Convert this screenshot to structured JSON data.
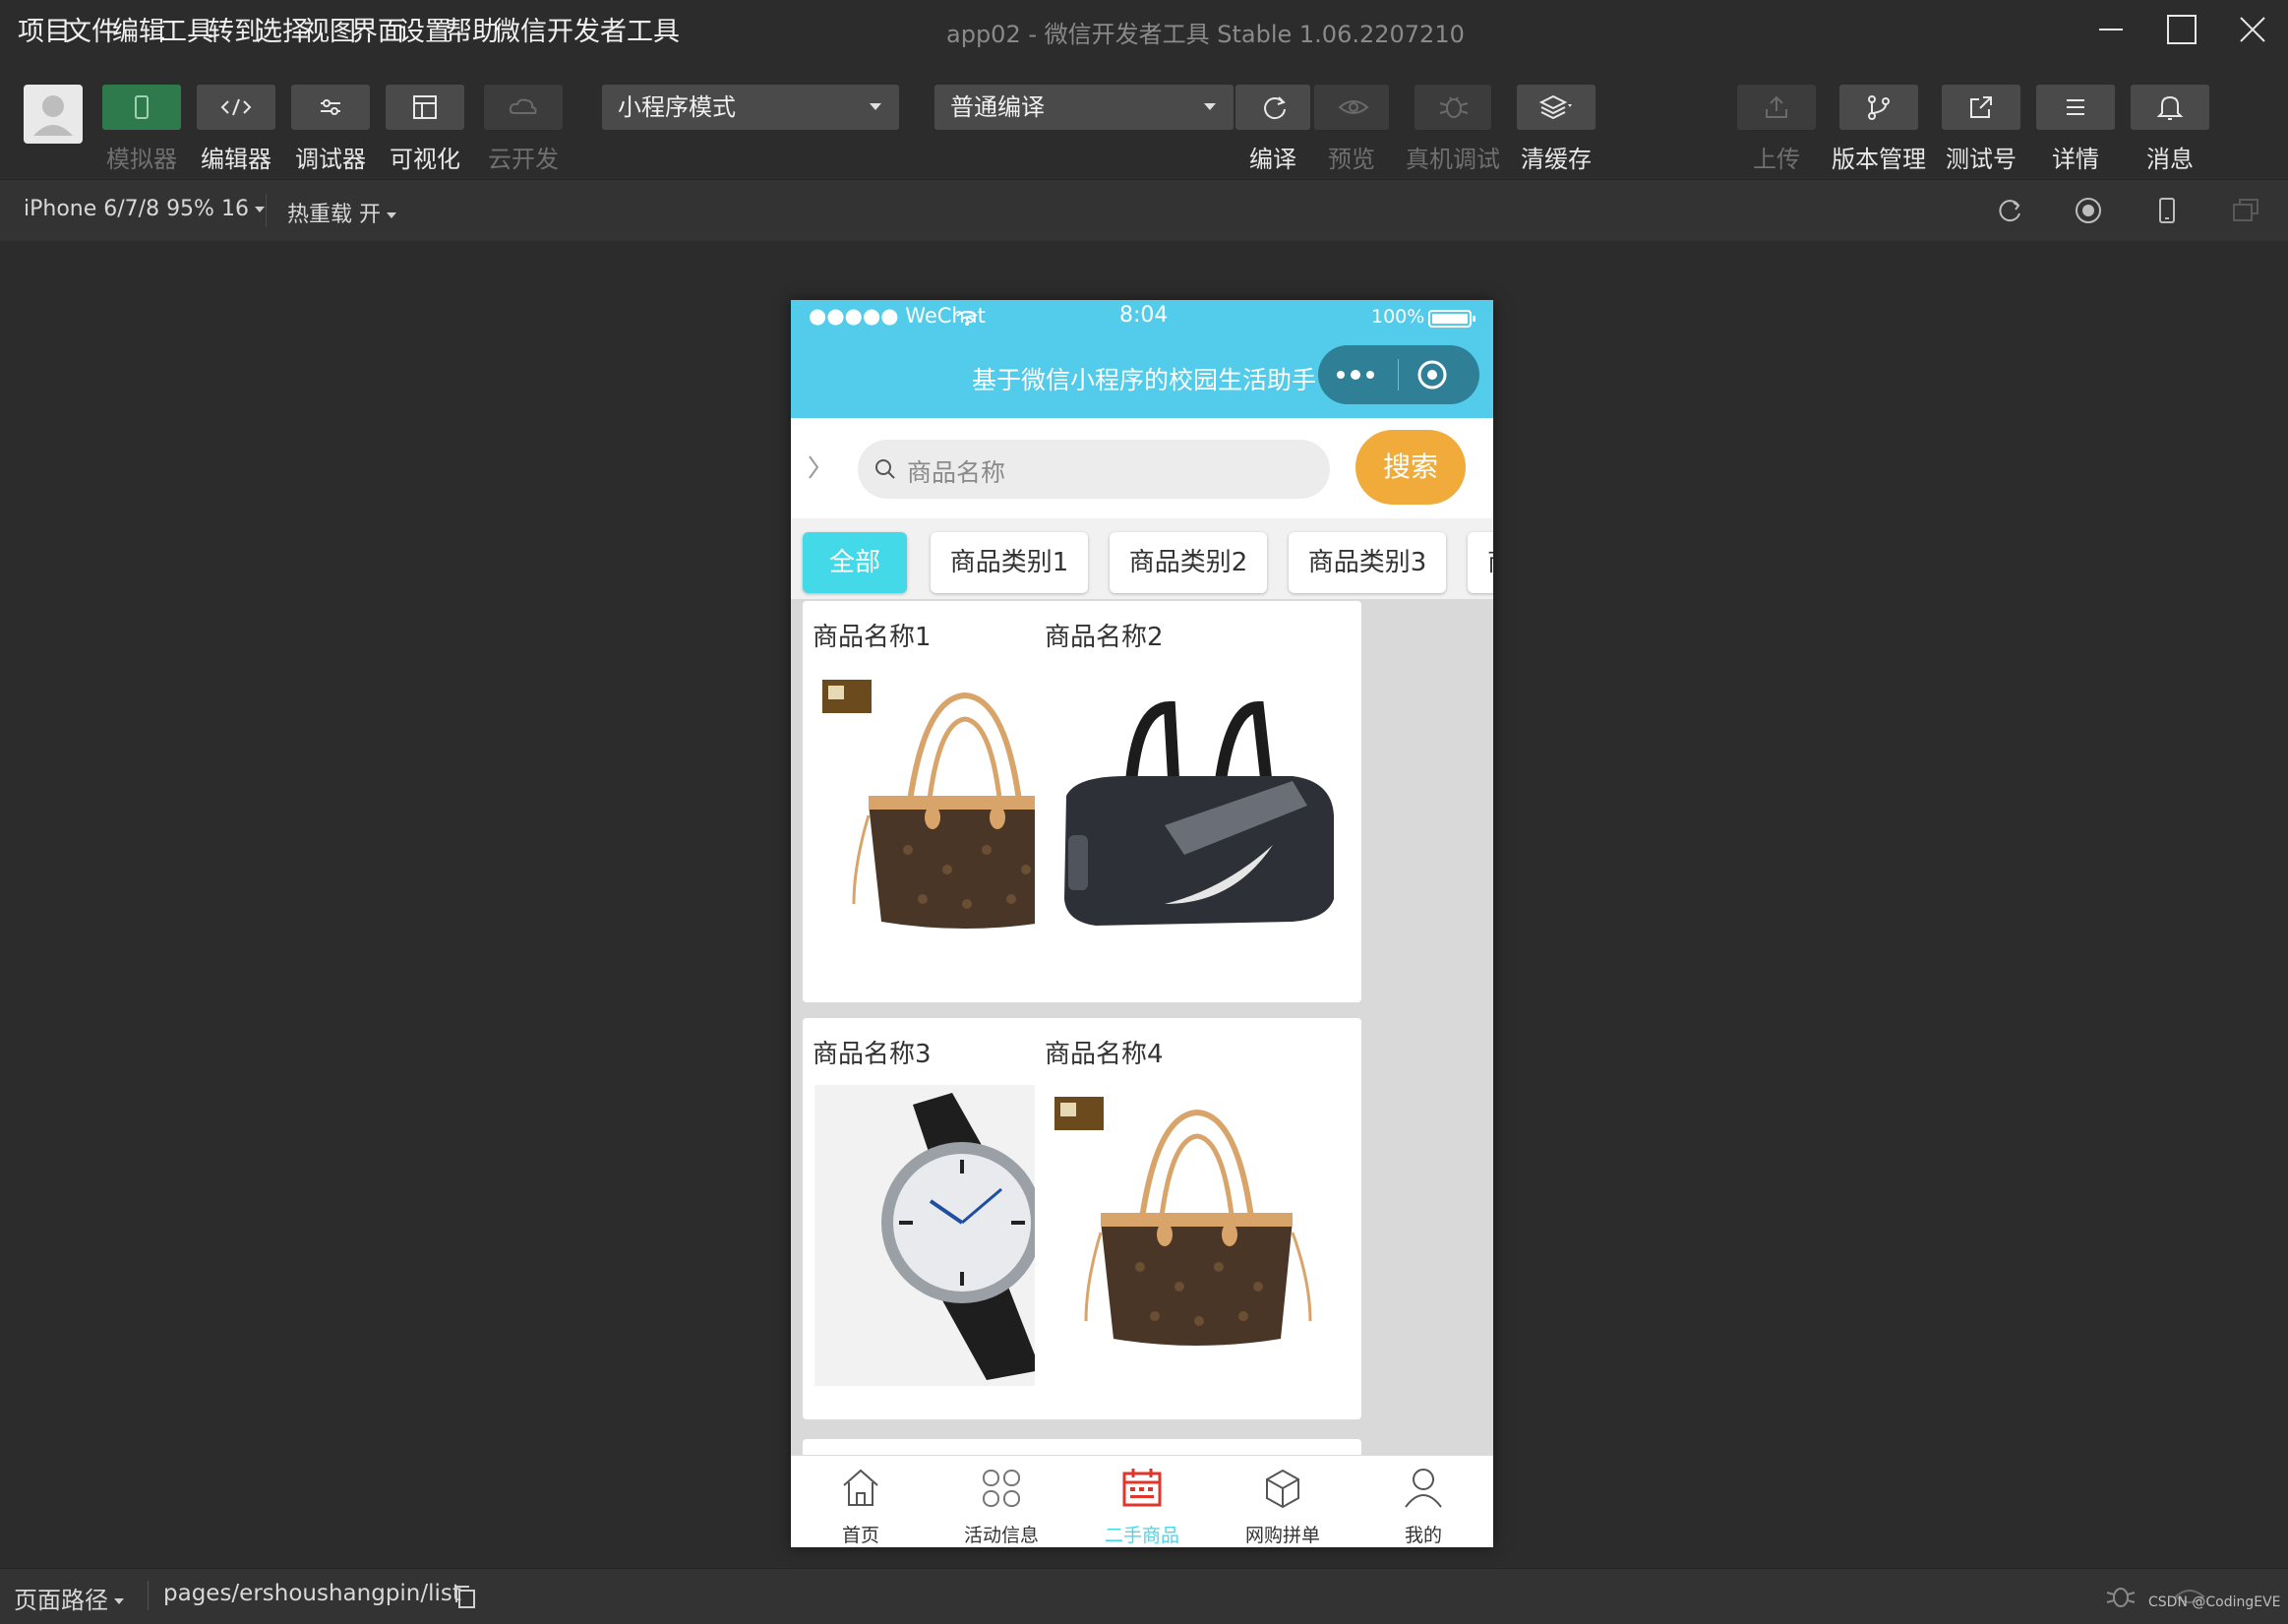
{
  "menu": [
    "项目",
    "文件",
    "编辑",
    "工具",
    "转到",
    "选择",
    "视图",
    "界面",
    "设置",
    "帮助",
    "微信开发者工具"
  ],
  "window_title": "app02 - 微信开发者工具 Stable 1.06.2207210",
  "toolbar": {
    "left_buttons": [
      {
        "label": "模拟器",
        "icon": "phone-icon",
        "state": "active"
      },
      {
        "label": "编辑器",
        "icon": "code-icon",
        "state": "normal"
      },
      {
        "label": "调试器",
        "icon": "sliders-icon",
        "state": "normal"
      },
      {
        "label": "可视化",
        "icon": "layout-icon",
        "state": "normal"
      },
      {
        "label": "云开发",
        "icon": "cloud-icon",
        "state": "disabled"
      }
    ],
    "mode_select": "小程序模式",
    "compile_select": "普通编译",
    "action_buttons": [
      {
        "label": "编译",
        "icon": "refresh-icon",
        "state": "normal"
      },
      {
        "label": "预览",
        "icon": "eye-icon",
        "state": "disabled"
      },
      {
        "label": "真机调试",
        "icon": "bug-icon",
        "state": "disabled"
      },
      {
        "label": "清缓存",
        "icon": "layers-icon",
        "state": "normal"
      }
    ],
    "right_buttons": [
      {
        "label": "上传",
        "icon": "upload-icon",
        "state": "disabled"
      },
      {
        "label": "版本管理",
        "icon": "branch-icon",
        "state": "normal"
      },
      {
        "label": "测试号",
        "icon": "external-link-icon",
        "state": "normal"
      },
      {
        "label": "详情",
        "icon": "menu-icon",
        "state": "normal"
      },
      {
        "label": "消息",
        "icon": "bell-icon",
        "state": "normal"
      }
    ]
  },
  "subbar": {
    "device": "iPhone 6/7/8 95% 16",
    "hot_reload": "热重载 开"
  },
  "phone": {
    "signal": "●●●●● WeChat",
    "time": "8:04",
    "battery": "100%",
    "nav_title": "基于微信小程序的校园生活助手",
    "search_placeholder": "商品名称",
    "search_button": "搜索",
    "tabs": [
      "全部",
      "商品类别1",
      "商品类别2",
      "商品类别3",
      "商"
    ],
    "products": [
      {
        "name": "商品名称1",
        "image": "handbag"
      },
      {
        "name": "商品名称2",
        "image": "duffel-bag"
      },
      {
        "name": "商品名称3",
        "image": "watch"
      },
      {
        "name": "商品名称4",
        "image": "handbag"
      }
    ],
    "tabbar": [
      {
        "label": "首页",
        "icon": "home-icon"
      },
      {
        "label": "活动信息",
        "icon": "grid-icon"
      },
      {
        "label": "二手商品",
        "icon": "calendar-icon",
        "active": true
      },
      {
        "label": "网购拼单",
        "icon": "box-icon"
      },
      {
        "label": "我的",
        "icon": "user-icon"
      }
    ]
  },
  "bottombar": {
    "path_label": "页面路径",
    "path": "pages/ershoushangpin/list",
    "watermark": "CSDN @CodingEVE"
  },
  "colors": {
    "accent_cyan": "#52ccea",
    "tab_active": "#43d9e8",
    "search_button": "#f0ab3b",
    "tabbar_active": "#e0342c"
  }
}
